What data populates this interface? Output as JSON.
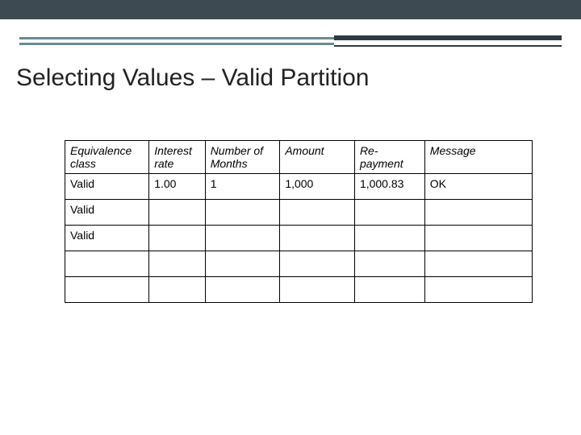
{
  "title": "Selecting Values – Valid Partition",
  "chart_data": {
    "type": "table",
    "title": "Selecting Values – Valid Partition",
    "columns": [
      "Equivalence class",
      "Interest rate",
      "Number of Months",
      "Amount",
      "Re-payment",
      "Message"
    ],
    "rows": [
      {
        "equivalence_class": "Valid",
        "interest_rate": "1.00",
        "number_of_months": "1",
        "amount": "1,000",
        "repayment": "1,000.83",
        "message": "OK"
      },
      {
        "equivalence_class": "Valid",
        "interest_rate": "",
        "number_of_months": "",
        "amount": "",
        "repayment": "",
        "message": ""
      },
      {
        "equivalence_class": "Valid",
        "interest_rate": "",
        "number_of_months": "",
        "amount": "",
        "repayment": "",
        "message": ""
      },
      {
        "equivalence_class": "",
        "interest_rate": "",
        "number_of_months": "",
        "amount": "",
        "repayment": "",
        "message": ""
      },
      {
        "equivalence_class": "",
        "interest_rate": "",
        "number_of_months": "",
        "amount": "",
        "repayment": "",
        "message": ""
      }
    ]
  }
}
